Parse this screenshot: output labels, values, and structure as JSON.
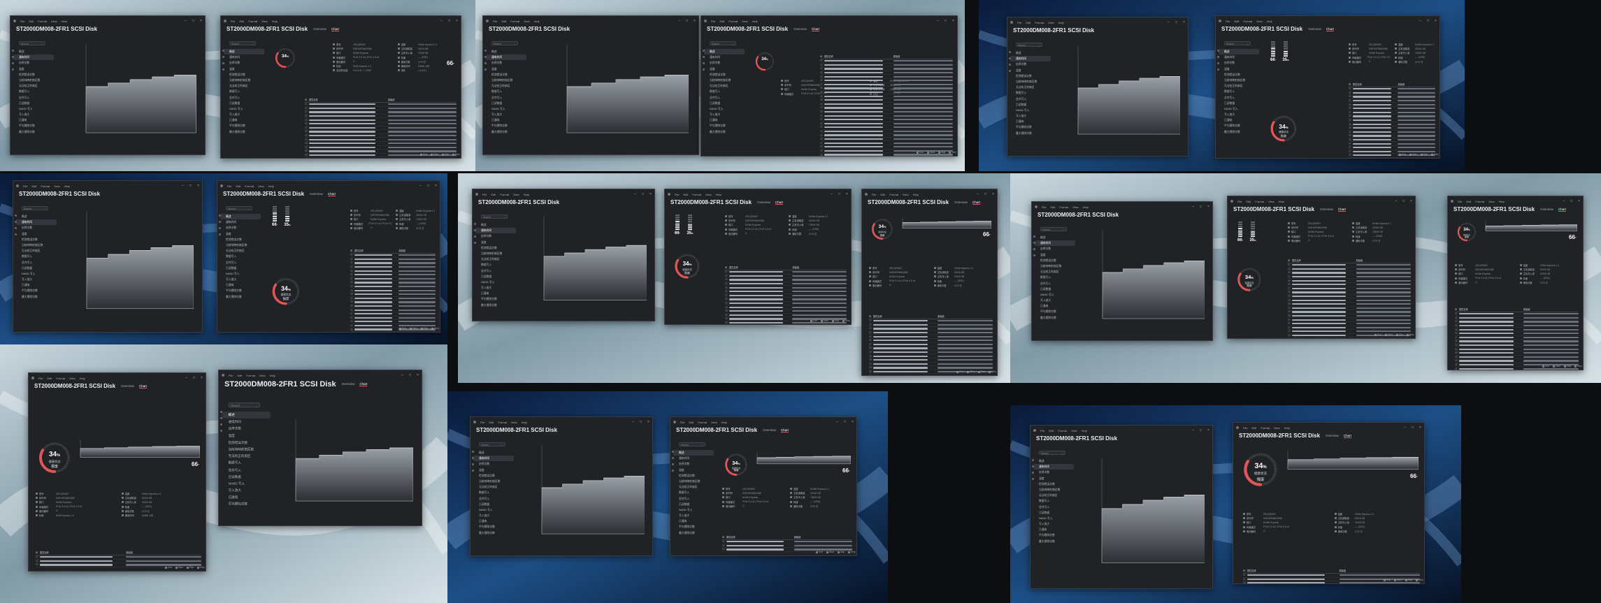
{
  "app": {
    "disk_title": "ST2000DM008-2FR1 SCSI Disk",
    "menu": [
      "File",
      "Edit",
      "Format",
      "View",
      "Help"
    ],
    "window_controls": [
      "–",
      "□",
      "×"
    ],
    "tabs": [
      "Overview",
      "Chart"
    ],
    "search_placeholder": "Search"
  },
  "nav_items": [
    "概述",
    "通电时间",
    "启停次数",
    "温度",
    "检测错误次数",
    "当前待映射扇区数",
    "无法校正的扇区",
    "数据写入",
    "总共写入",
    "已读数据",
    "NAND 写入",
    "写入放大",
    "已通电",
    "平均擦除次数",
    "最大擦除次数"
  ],
  "health": {
    "percent_value": "34",
    "percent_unit": "%",
    "percent": 34,
    "status_label": "健康状态",
    "status_value": "报废"
  },
  "temperature": {
    "value": "66",
    "unit": "°",
    "level": 0.66
  },
  "secondary_temp": {
    "value": "35",
    "unit": "%",
    "level": 0.35
  },
  "chart_data": {
    "type": "area",
    "title": "",
    "xlabel": "",
    "ylabel": "",
    "x": [
      0,
      1,
      2,
      3,
      4
    ],
    "values": [
      52,
      56,
      60,
      63,
      65
    ],
    "ylim": [
      0,
      100
    ],
    "series": [
      {
        "values": [
          52,
          56,
          60,
          63,
          65
        ]
      }
    ],
    "grid": true,
    "color": "#8a8f96"
  },
  "info_pairs": [
    {
      "k": "型号",
      "v": "2ECQR4W7"
    },
    {
      "k": "温度",
      "v": "NVMe Express 1.3"
    },
    {
      "k": "序列号",
      "v": "S4EVNF0M42086"
    },
    {
      "k": "主机读取量",
      "v": "32016 GB"
    },
    {
      "k": "接口",
      "v": "NVMe Express"
    },
    {
      "k": "主机写入量",
      "v": "73405 GB"
    },
    {
      "k": "传输模式",
      "v": "PCIe 3.0 x4 | PCIe 3.0 x4"
    },
    {
      "k": "转速",
      "v": "---- (SSD)"
    },
    {
      "k": "驱动器号",
      "v": "C:"
    },
    {
      "k": "通电次数",
      "v": "1175 次"
    },
    {
      "k": "标准",
      "v": "NVM Express 1.3"
    },
    {
      "k": "通电时间",
      "v": "10986 小时"
    },
    {
      "k": "支持的功能",
      "v": "S.M.A.R.T., TRIM"
    },
    {
      "k": "固件",
      "v": "2.4.6.8.1"
    }
  ],
  "table": {
    "headers": [
      "ID",
      "属性名称",
      "原始值"
    ],
    "row_ids": [
      "01",
      "02",
      "03",
      "04",
      "05",
      "06",
      "07",
      "08",
      "09",
      "0A",
      "0B",
      "0C",
      "0D",
      "0E",
      "0F"
    ]
  },
  "footer": [
    "Sort",
    "Start",
    "Stop",
    "Help"
  ],
  "colors": {
    "accent": "#e05555",
    "bg": "#202226",
    "panel": "#2a2d32"
  }
}
